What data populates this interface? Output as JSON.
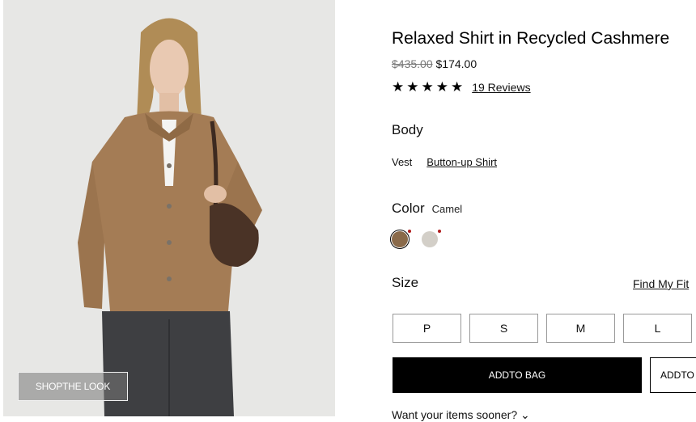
{
  "product": {
    "title": "Relaxed Shirt in Recycled Cashmere",
    "price_original": "$435.00",
    "price_sale": "$174.00",
    "rating_stars": "★★★★★",
    "reviews_label": "19 Reviews"
  },
  "body": {
    "label": "Body",
    "options": [
      "Vest",
      "Button-up Shirt"
    ],
    "selected": "Button-up Shirt"
  },
  "color": {
    "label": "Color",
    "value": "Camel",
    "swatches": [
      {
        "name": "camel",
        "hex": "#8a6a4a"
      },
      {
        "name": "light-gray",
        "hex": "#d3cfc8"
      }
    ],
    "selected": "camel"
  },
  "size": {
    "label": "Size",
    "find_fit": "Find My Fit",
    "options": [
      "P",
      "S",
      "M",
      "L"
    ]
  },
  "actions": {
    "add_to_bag": "ADDTO BAG",
    "add_to_wishlist": "ADDTO"
  },
  "delivery_prompt": "Want your items sooner?",
  "photo": {
    "shop_the_look": "SHOPTHE LOOK"
  }
}
